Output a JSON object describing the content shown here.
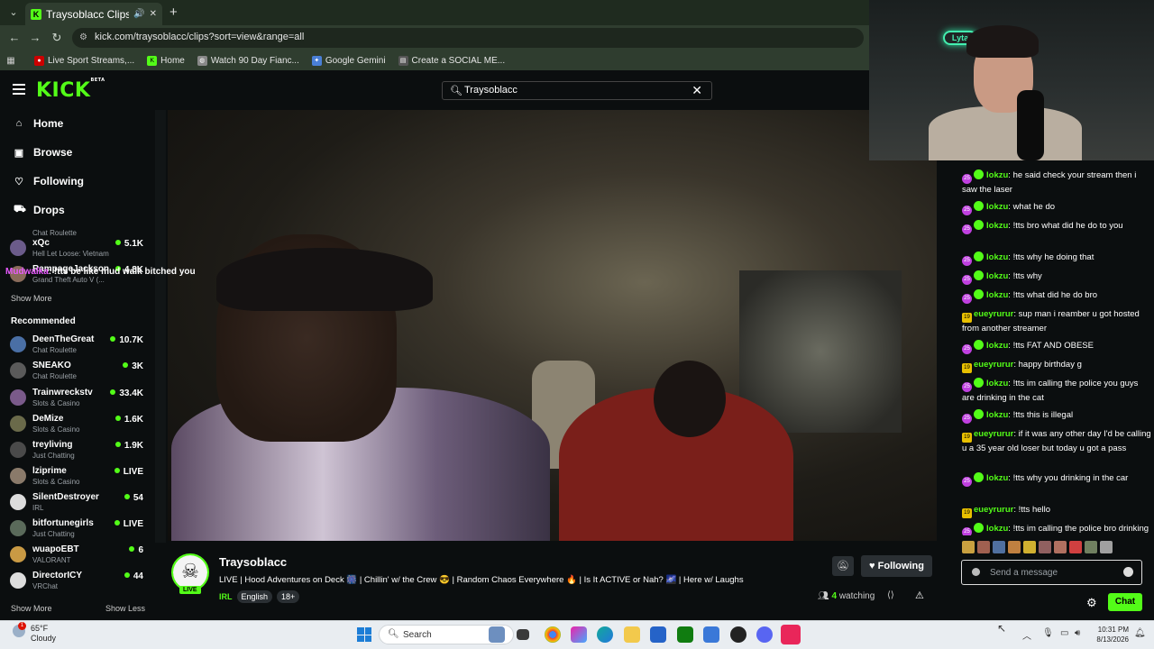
{
  "browser": {
    "tab_title": "Traysoblacc Clips - Watch Li",
    "url": "kick.com/traysoblacc/clips?sort=view&range=all",
    "bookmarks": [
      "Live Sport Streams,...",
      "Home",
      "Watch 90 Day Fianc...",
      "Google Gemini",
      "Create a SOCIAL ME..."
    ]
  },
  "header": {
    "logo": "KICK",
    "logo_badge": "BETA",
    "search_value": "Traysoblacc"
  },
  "sidebar": {
    "nav": [
      {
        "label": "Home",
        "icon": "home-icon"
      },
      {
        "label": "Browse",
        "icon": "browse-icon"
      },
      {
        "label": "Following",
        "icon": "heart-icon"
      },
      {
        "label": "Drops",
        "icon": "drops-icon"
      }
    ],
    "following": [
      {
        "name": "",
        "game": "Chat Roulette",
        "viewers": ""
      },
      {
        "name": "xQc",
        "game": "Hell Let Loose: Vietnam",
        "viewers": "5.1K"
      },
      {
        "name": "RampageJackson",
        "game": "Grand Theft Auto V (...",
        "viewers": "4.8K"
      }
    ],
    "show_more_1": "Show More",
    "recommended_heading": "Recommended",
    "recommended": [
      {
        "name": "DeenTheGreat",
        "game": "Chat Roulette",
        "viewers": "10.7K"
      },
      {
        "name": "SNEAKO",
        "game": "Chat Roulette",
        "viewers": "3K"
      },
      {
        "name": "Trainwreckstv",
        "game": "Slots & Casino",
        "viewers": "33.4K"
      },
      {
        "name": "DeMize",
        "game": "Slots & Casino",
        "viewers": "1.6K"
      },
      {
        "name": "treyliving",
        "game": "Just Chatting",
        "viewers": "1.9K"
      },
      {
        "name": "lziprime",
        "game": "Slots & Casino",
        "viewers": "LIVE"
      },
      {
        "name": "SilentDestroyer",
        "game": "IRL",
        "viewers": "54"
      },
      {
        "name": "bitfortunegirls",
        "game": "Just Chatting",
        "viewers": "LIVE"
      },
      {
        "name": "wuapoEBT",
        "game": "VALORANT",
        "viewers": "6"
      },
      {
        "name": "DirectorICY",
        "game": "VRChat",
        "viewers": "44"
      }
    ],
    "show_more_2": "Show More",
    "show_less": "Show Less"
  },
  "overlay_chat": {
    "user": "Mudwalka",
    "text": ": !tts be like mud walk bitched you"
  },
  "stream": {
    "name": "Traysoblacc",
    "live_label": "LIVE",
    "title": "LIVE | Hood Adventures on Deck 🎆 | Chillin' w/ the Crew 😎 | Random Chaos Everywhere 🔥 | Is It ACTIVE or Nah? 🌌 | Here w/ Laughs",
    "category": "IRL",
    "tags": [
      "English",
      "18+"
    ],
    "follow_label": "Following",
    "watching_count": "4",
    "watching_label": "watching"
  },
  "chat": {
    "messages": [
      {
        "user": "lokzu",
        "badge": "25",
        "text": "he said check your stream then i saw the laser"
      },
      {
        "user": "lokzu",
        "badge": "25",
        "text": "what he do"
      },
      {
        "user": "lokzu",
        "badge": "25",
        "text": "!tts bro what did he do to you"
      },
      {
        "user": "lokzu",
        "badge": "25",
        "text": "!tts why he doing that"
      },
      {
        "user": "lokzu",
        "badge": "25",
        "text": "!tts why"
      },
      {
        "user": "lokzu",
        "badge": "25",
        "text": "!tts what did he do bro"
      },
      {
        "user": "eueyrurur",
        "badge": "19",
        "text": "sup man i reamber u got hosted from another streamer"
      },
      {
        "user": "lokzu",
        "badge": "25",
        "text": "!tts FAT AND OBESE"
      },
      {
        "user": "eueyrurur",
        "badge": "19",
        "text": "happy birthday g"
      },
      {
        "user": "lokzu",
        "badge": "25",
        "text": "!tts im calling the police you guys are drinking in the cat"
      },
      {
        "user": "lokzu",
        "badge": "25",
        "text": "!tts this is illegal"
      },
      {
        "user": "eueyrurur",
        "badge": "19",
        "text": "if it was any other day I'd be calling u a 35 year old loser but today u got a pass"
      },
      {
        "user": "lokzu",
        "badge": "25",
        "text": "!tts why you drinking in the car"
      },
      {
        "user": "eueyrurur",
        "badge": "19",
        "text": "!tts hello"
      },
      {
        "user": "lokzu",
        "badge": "25",
        "text": "!tts im calling the police bro drinking and driving isnt cool"
      }
    ],
    "input_placeholder": "Send a message",
    "send_label": "Chat"
  },
  "webcam": {
    "neon_text": "Lyta"
  },
  "taskbar": {
    "temp": "65°F",
    "condition": "Cloudy",
    "notification_count": "1",
    "search_placeholder": "Search",
    "time": "10:31 PM",
    "date": "8/13/2026"
  },
  "colors": {
    "accent": "#53fc18",
    "background": "#0b0e0f"
  }
}
